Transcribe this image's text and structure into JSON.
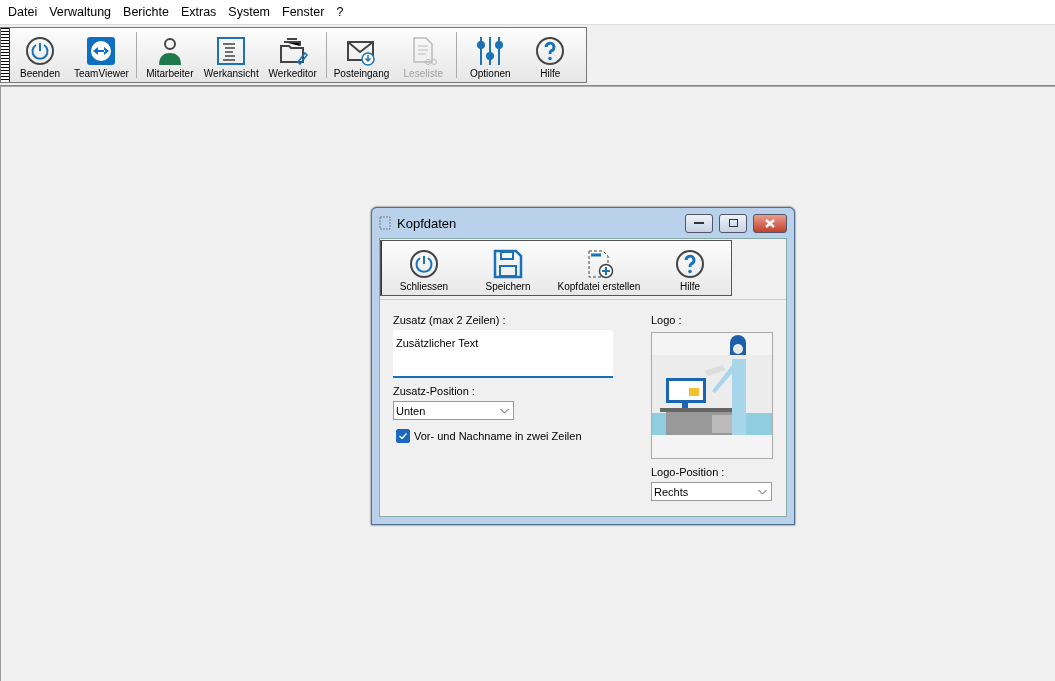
{
  "menu": [
    "Datei",
    "Verwaltung",
    "Berichte",
    "Extras",
    "System",
    "Fenster",
    "?"
  ],
  "toolbar": {
    "groups": [
      [
        {
          "label": "Beenden",
          "kind": "power",
          "disabled": false
        },
        {
          "label": "TeamViewer",
          "kind": "remote",
          "disabled": false
        }
      ],
      [
        {
          "label": "Mitarbeiter",
          "kind": "person",
          "disabled": false
        },
        {
          "label": "Werkansicht",
          "kind": "list",
          "disabled": false
        },
        {
          "label": "Werkeditor",
          "kind": "folder",
          "disabled": false
        }
      ],
      [
        {
          "label": "Posteingang",
          "kind": "mail",
          "disabled": false
        },
        {
          "label": "Leseliste",
          "kind": "document",
          "disabled": true
        }
      ],
      [
        {
          "label": "Optionen",
          "kind": "sliders",
          "disabled": false
        },
        {
          "label": "Hilfe",
          "kind": "help",
          "disabled": false
        }
      ]
    ]
  },
  "dialog": {
    "title": "Kopfdaten",
    "toolbar": [
      {
        "label": "Schliessen",
        "kind": "power",
        "disabled": false
      },
      {
        "label": "Speichern",
        "kind": "save",
        "disabled": false
      },
      {
        "label": "Kopfdatei erstellen",
        "kind": "newfile",
        "disabled": false
      },
      {
        "label": "Hilfe",
        "kind": "help",
        "disabled": false
      }
    ],
    "zusatz": {
      "label": "Zusatz (max 2 Zeilen) :",
      "value": "Zusätzlicher Text\n"
    },
    "zusatz_position": {
      "label": "Zusatz-Position :",
      "value": "Unten"
    },
    "two_lines": {
      "label": "Vor- und Nachname in zwei Zeilen",
      "checked": true
    },
    "logo": {
      "label": "Logo :"
    },
    "logo_position": {
      "label": "Logo-Position :",
      "value": "Rechts"
    }
  }
}
